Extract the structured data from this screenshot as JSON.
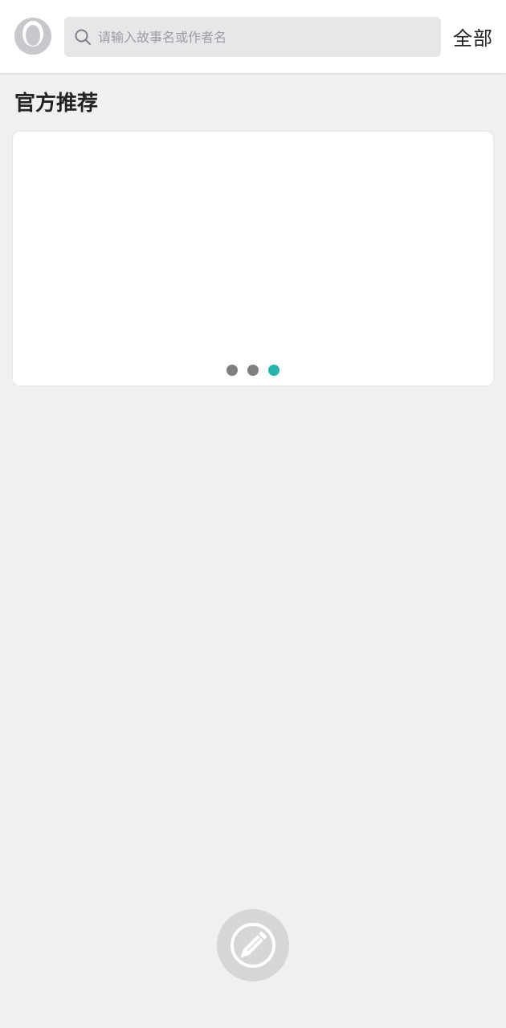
{
  "header": {
    "search": {
      "placeholder": "请输入故事名或作者名",
      "value": ""
    },
    "all_label": "全部"
  },
  "section": {
    "title": "官方推荐"
  },
  "carousel": {
    "slides": 3,
    "active_index": 2,
    "dot_color": "#7f7f7f",
    "active_dot_color": "#26b3b0"
  },
  "icons": {
    "avatar": "user-avatar-icon",
    "search": "search-icon",
    "compose": "edit-pencil-icon"
  }
}
